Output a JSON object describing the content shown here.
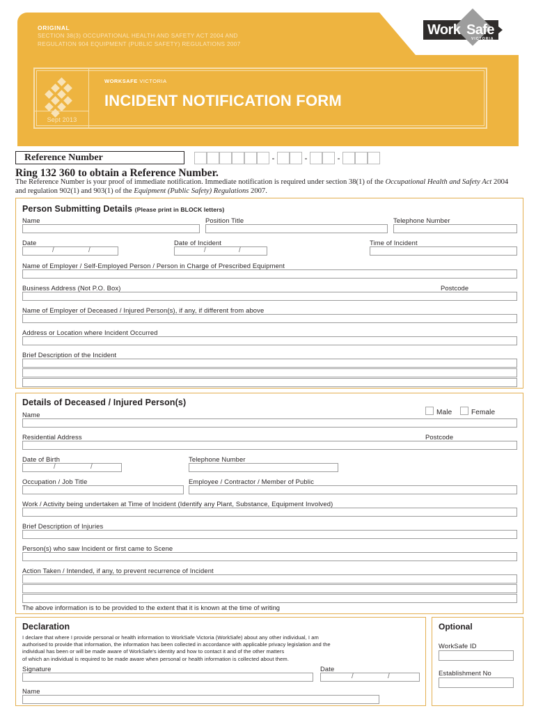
{
  "header": {
    "original_label": "ORIGINAL",
    "legal_line1": "SECTION 38(3) OCCUPATIONAL HEALTH AND SAFETY ACT 2004 AND",
    "legal_line2": "REGULATION 904 EQUIPMENT (PUBLIC SAFETY) REGULATIONS 2007",
    "logo": {
      "work": "Work",
      "safe": "Safe",
      "victoria": "VICTORIA"
    },
    "title_box": {
      "kicker_bold": "WORKSAFE",
      "kicker_light": "VICTORIA",
      "title": "INCIDENT NOTIFICATION FORM",
      "date": "Sept 2013"
    }
  },
  "reference": {
    "label": "Reference Number",
    "groups": [
      6,
      2,
      2,
      3
    ],
    "separator": "-",
    "ring_line": "Ring 132 360 to obtain a Reference Number.",
    "legal_1": "The Reference Number is your proof of immediate notification. Immediate notification is required under section 38(1) of the ",
    "legal_1_italic": "Occupational Health and Safety Act",
    "legal_2": " 2004 and regulation 902(1) and 903(1) of the ",
    "legal_2_italic": "Equipment (Public Safety) Regulations",
    "legal_3": " 2007."
  },
  "person_submitting": {
    "heading": "Person Submitting Details",
    "heading_sub": "(Please print in BLOCK letters)",
    "name": "Name",
    "position_title": "Position Title",
    "telephone_number": "Telephone Number",
    "date": "Date",
    "date_of_incident": "Date of Incident",
    "time_of_incident": "Time of Incident",
    "employer_name": "Name of Employer / Self-Employed Person / Person in Charge of Prescribed Equipment",
    "business_address": "Business Address (Not P.O. Box)",
    "postcode": "Postcode",
    "employer_of_deceased": "Name of Employer of Deceased / Injured Person(s), if any, if different from above",
    "incident_location": "Address or Location where Incident Occurred",
    "brief_description": "Brief Description of the Incident",
    "date_separator": "/"
  },
  "deceased_details": {
    "heading": "Details of Deceased / Injured Person(s)",
    "name": "Name",
    "male": "Male",
    "female": "Female",
    "residential_address": "Residential Address",
    "postcode": "Postcode",
    "date_of_birth": "Date of Birth",
    "telephone_number": "Telephone Number",
    "occupation": "Occupation / Job Title",
    "employee_type": "Employee / Contractor / Member of Public",
    "work_activity": "Work / Activity being undertaken at Time of Incident (Identify any Plant, Substance, Equipment Involved)",
    "brief_injuries": "Brief Description of Injuries",
    "witnesses": "Person(s) who saw Incident or first came to Scene",
    "action_taken": "Action Taken / Intended, if any, to prevent recurrence of Incident",
    "footnote": "The above information is to be provided to the extent that it is known at the time of writing",
    "date_separator": "/"
  },
  "declaration": {
    "heading": "Declaration",
    "body_line1": "I declare that where I provide personal or health information to WorkSafe Victoria (WorkSafe) about any other individual, I am",
    "body_line2": "authorised to provide that information, the information has been collected in accordance with applicable privacy legislation and the",
    "body_line3": "individual has been or will be made aware of WorkSafe's identity and how to contact it and of the other matters",
    "body_line4": "of which an individual is required to be made aware when personal or health information is collected about them.",
    "signature": "Signature",
    "date": "Date",
    "name": "Name",
    "date_separator": "/"
  },
  "optional": {
    "heading": "Optional",
    "worksafe_id": "WorkSafe ID",
    "establishment_no": "Establishment No"
  },
  "colors": {
    "brand_orange": "#eeb440",
    "brand_orange_light": "#f7dfae",
    "border_orange": "#e3ae4e",
    "logo_dark": "#2f2c2b",
    "logo_gray": "#9d9d9d",
    "field_border": "#9b9b9b"
  }
}
